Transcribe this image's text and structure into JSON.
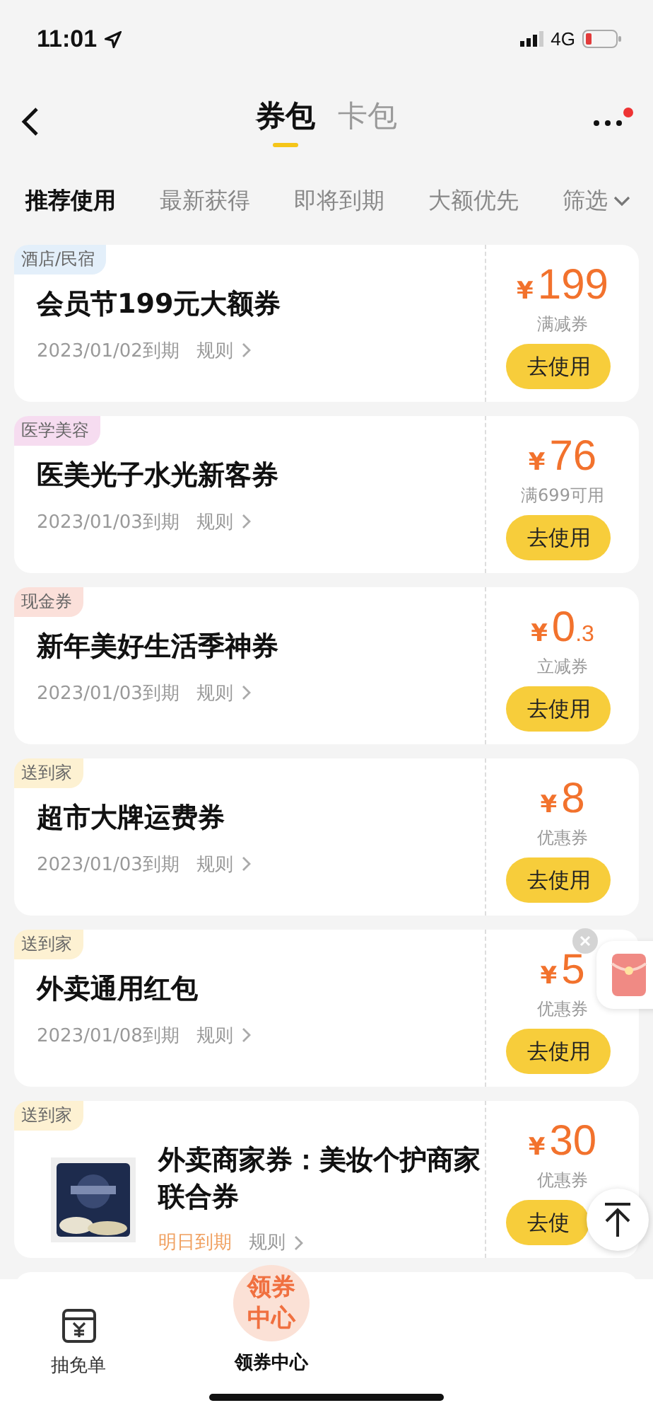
{
  "status_bar": {
    "time": "11:01",
    "network": "4G"
  },
  "header": {
    "tabs": [
      {
        "label": "券包",
        "selected": true
      },
      {
        "label": "卡包",
        "selected": false
      }
    ],
    "menu_dot": true
  },
  "filters": [
    {
      "label": "推荐使用",
      "selected": true
    },
    {
      "label": "最新获得",
      "selected": false
    },
    {
      "label": "即将到期",
      "selected": false
    },
    {
      "label": "大额优先",
      "selected": false
    },
    {
      "label": "筛选",
      "selected": false,
      "kind": "dropdown"
    }
  ],
  "coupons": [
    {
      "tag": "酒店/民宿",
      "color": "#e3effa",
      "title": "会员节199元大额券",
      "expiry": "2023/01/02到期",
      "urgent": false,
      "rules": "规则",
      "currency": "¥",
      "amount": "199",
      "type": "满减券",
      "button": "去使用"
    },
    {
      "tag": "医学美容",
      "color": "#f6dcf0",
      "title": "医美光子水光新客券",
      "expiry": "2023/01/03到期",
      "urgent": false,
      "rules": "规则",
      "currency": "¥",
      "amount": "76",
      "type": "满699可用",
      "button": "去使用"
    },
    {
      "tag": "现金券",
      "color": "#fbe0da",
      "title": "新年美好生活季神券",
      "expiry": "2023/01/03到期",
      "urgent": false,
      "rules": "规则",
      "currency": "¥",
      "amount": "0",
      "fraction": ".3",
      "type": "立减券",
      "button": "去使用"
    },
    {
      "tag": "送到家",
      "color": "#fdf1d2",
      "title": "超市大牌运费券",
      "expiry": "2023/01/03到期",
      "urgent": false,
      "rules": "规则",
      "currency": "¥",
      "amount": "8",
      "type": "优惠券",
      "button": "去使用"
    },
    {
      "tag": "送到家",
      "color": "#fdf1d2",
      "title": "外卖通用红包",
      "expiry": "2023/01/08到期",
      "urgent": false,
      "rules": "规则",
      "currency": "¥",
      "amount": "5",
      "type": "优惠券",
      "button": "去使用"
    },
    {
      "tag": "送到家",
      "color": "#fdf1d2",
      "title": "外卖商家券：美妆个护商家联合券",
      "expiry": "明日到期",
      "urgent": true,
      "rules": "规则",
      "currency": "¥",
      "amount": "30",
      "type": "优惠券",
      "button": "去使"
    }
  ],
  "bottom_nav": [
    {
      "label": "抽免单",
      "kind": "ticket"
    },
    {
      "label": "领券中心",
      "kind": "center",
      "badge": "领券中心"
    }
  ]
}
